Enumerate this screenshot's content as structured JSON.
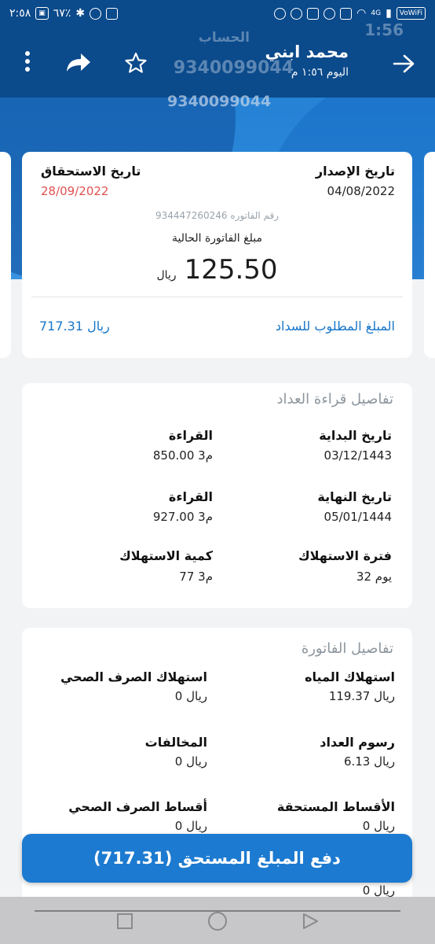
{
  "status": {
    "time": "٢:٥٨",
    "battery": "٦٧٪",
    "network": "4G",
    "wifi_call": "VoWiFi"
  },
  "background": {
    "account_label": "الحساب",
    "account_number_1": "9340099044",
    "account_number_2": "9340099044",
    "time": "1:56"
  },
  "chat": {
    "contact_name": "محمد ابني",
    "last_seen": "اليوم ١:٥٦ م",
    "icons": [
      "back-arrow-icon",
      "star-icon",
      "forward-icon",
      "more-vert-icon"
    ]
  },
  "bill": {
    "issue_label": "تاريخ الإصدار",
    "issue_date": "04/08/2022",
    "due_label": "تاريخ الاستحقاق",
    "due_date": "28/09/2022",
    "invoice_number": "رقم الفاتوره 934447260246",
    "current_amount_label": "مبلغ الفاتورة الحالية",
    "current_amount": "125.50",
    "currency": "ريال",
    "required_label": "المبلغ المطلوب للسداد",
    "required_amount": "717.31 ريال"
  },
  "meter": {
    "title": "تفاصيل قراءة العداد",
    "start_date_label": "تاريخ البداية",
    "start_date": "03/12/1443",
    "start_reading_label": "القراءة",
    "start_reading": "850.00 م3",
    "end_date_label": "تاريخ النهاية",
    "end_date": "05/01/1444",
    "end_reading_label": "القراءة",
    "end_reading": "927.00 م3",
    "period_label": "فترة الاستهلاك",
    "period": "32 يوم",
    "quantity_label": "كمية الاستهلاك",
    "quantity": "77 م3"
  },
  "details": {
    "title": "تفاصيل الفاتورة",
    "water_label": "استهلاك المياه",
    "water": "119.37 ريال",
    "sewage_label": "استهلاك الصرف الصحي",
    "sewage": "0 ريال",
    "meter_fee_label": "رسوم العداد",
    "meter_fee": "6.13 ريال",
    "violations_label": "المخالفات",
    "violations": "0 ريال",
    "installments_label": "الأقساط المستحقة",
    "installments": "0 ريال",
    "sewage_installments_label": "أقساط الصرف الصحي",
    "sewage_installments": "0 ريال",
    "extra_value": "0 ريال"
  },
  "pay_button": "دفع المبلغ المستحق (717.31)",
  "colors": {
    "primary": "#1c7ad0",
    "header_dark": "#0b4a8b",
    "due_red": "#e05050"
  }
}
